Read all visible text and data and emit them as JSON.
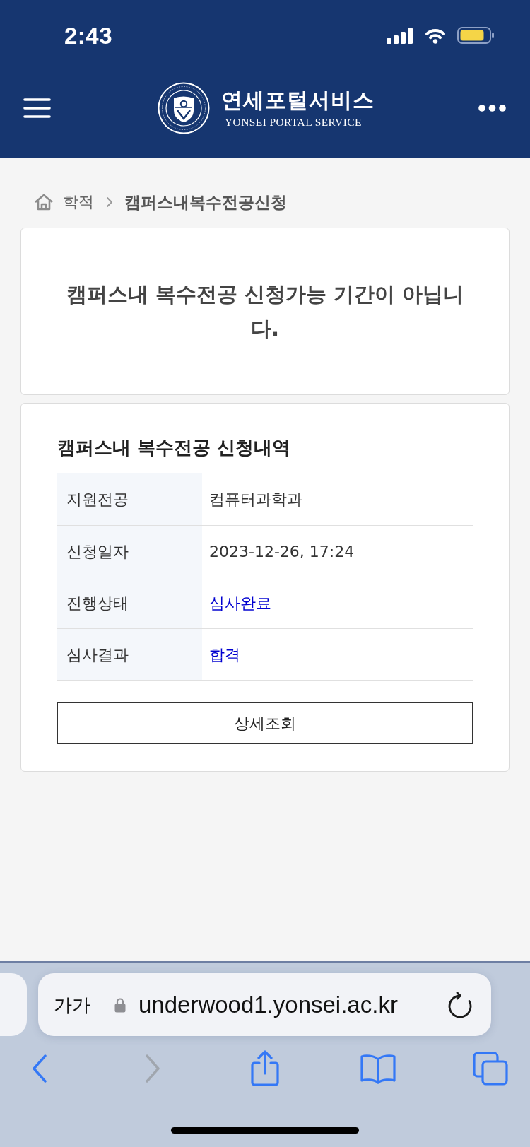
{
  "status_bar": {
    "time": "2:43"
  },
  "header": {
    "title": "연세포털서비스",
    "subtitle": "YONSEI PORTAL SERVICE"
  },
  "breadcrumb": [
    {
      "label": "학적",
      "current": false
    },
    {
      "label": "캠퍼스내복수전공신청",
      "current": true
    }
  ],
  "notice": {
    "message": "캠퍼스내 복수전공 신청가능 기간이 아닙니다."
  },
  "application": {
    "title": "캠퍼스내 복수전공 신청내역",
    "rows": [
      {
        "label": "지원전공",
        "value": "컴퓨터과학과",
        "kind": "text"
      },
      {
        "label": "신청일자",
        "value": "2023-12-26, 17:24",
        "kind": "text"
      },
      {
        "label": "진행상태",
        "value": "심사완료",
        "kind": "status"
      },
      {
        "label": "심사결과",
        "value": "합격",
        "kind": "status"
      }
    ],
    "button": "상세조회"
  },
  "browser": {
    "text_size_button": "가가",
    "url": "underwood1.yonsei.ac.kr",
    "toolbar": [
      {
        "kind": "back",
        "disabled": false
      },
      {
        "kind": "forward",
        "disabled": true
      },
      {
        "kind": "share",
        "disabled": false
      },
      {
        "kind": "bookmarks",
        "disabled": false
      },
      {
        "kind": "tabs",
        "disabled": false
      }
    ]
  }
}
